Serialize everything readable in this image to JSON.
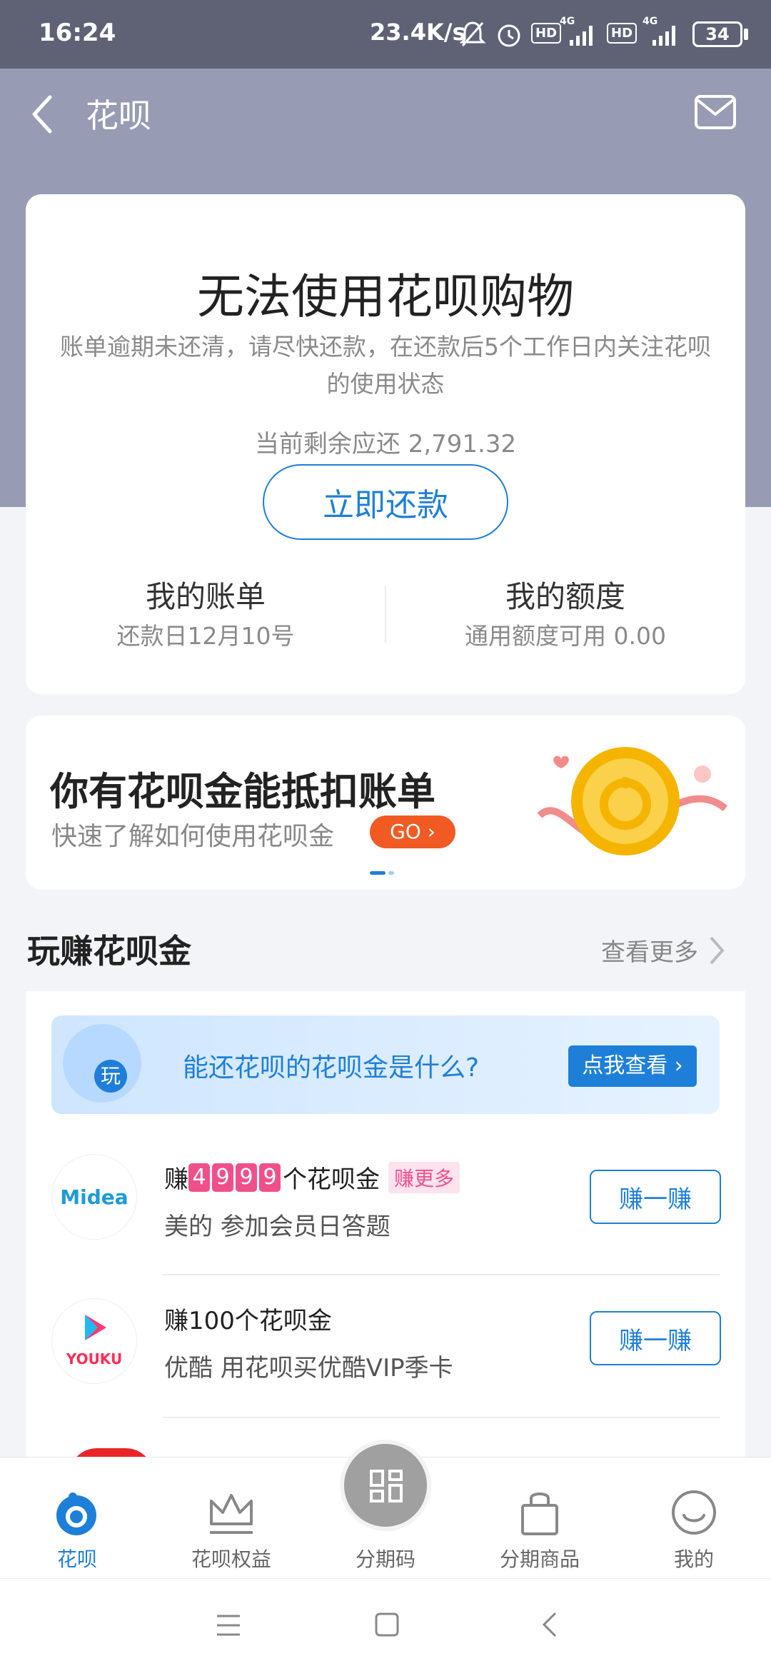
{
  "status_bar": {
    "time": "16:24",
    "speed": "23.4K/s",
    "battery": "34",
    "hd1": "HD",
    "hd2": "HD",
    "net1": "4G",
    "net2": "4G"
  },
  "header": {
    "title": "花呗"
  },
  "status_card": {
    "title": "无法使用花呗购物",
    "description": "账单逾期未还清，请尽快还款，在还款后5个工作日内关注花呗的使用状态",
    "balance_text": "当前剩余应还 2,791.32",
    "repay_button": "立即还款",
    "bill_title": "我的账单",
    "bill_sub": "还款日12月10号",
    "quota_title": "我的额度",
    "quota_sub": "通用额度可用 0.00"
  },
  "banner": {
    "title": "你有花呗金能抵扣账单",
    "subtitle": "快速了解如何使用花呗金",
    "go": "GO"
  },
  "section": {
    "title": "玩赚花呗金",
    "more": "查看更多"
  },
  "promo": {
    "text": "能还花呗的花呗金是什么?",
    "button": "点我查看",
    "badge": "玩"
  },
  "tasks": [
    {
      "logo": "Midea",
      "prefix": "赚",
      "digits": [
        "4",
        "9",
        "9",
        "9"
      ],
      "suffix": "个花呗金",
      "tag": "赚更多",
      "desc": "美的 参加会员日答题",
      "button": "赚一赚"
    },
    {
      "logo": "YOUKU",
      "title": "赚100个花呗金",
      "desc": "优酷 用花呗买优酷VIP季卡",
      "button": "赚一赚"
    }
  ],
  "tabs": [
    {
      "label": "花呗",
      "icon": "huabei-icon"
    },
    {
      "label": "花呗权益",
      "icon": "crown-icon"
    },
    {
      "label": "分期码",
      "icon": "qr-code-icon"
    },
    {
      "label": "分期商品",
      "icon": "shopping-bag-icon"
    },
    {
      "label": "我的",
      "icon": "smile-icon"
    }
  ],
  "colors": {
    "accent": "#1e7fd8",
    "header": "#979bb3",
    "active_tab": "#1e7fd8",
    "go_button": "#f15a22",
    "number_pink": "#f0508a"
  }
}
